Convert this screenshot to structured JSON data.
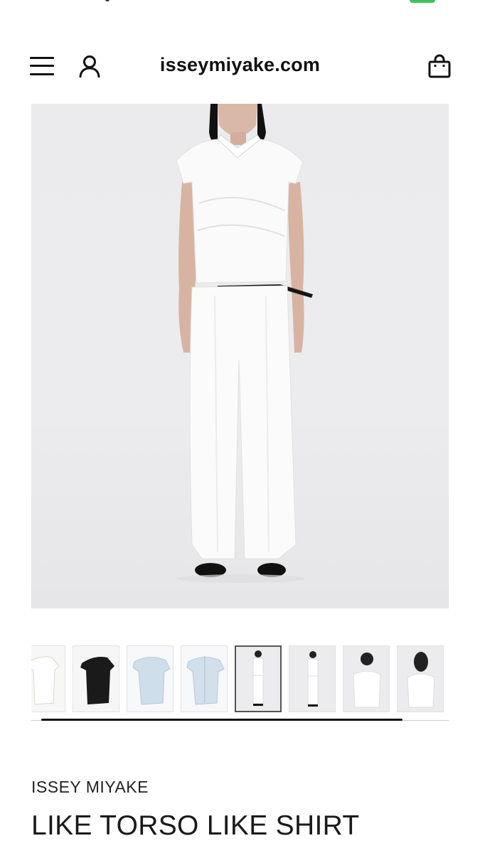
{
  "header": {
    "site_title": "isseymiyake.com",
    "icons": {
      "menu": "hamburger-menu-icon",
      "account": "user-icon",
      "cart": "shopping-bag-icon"
    }
  },
  "product": {
    "brand": "ISSEY MIYAKE",
    "title": "LIKE TORSO LIKE SHIRT"
  },
  "gallery": {
    "thumbnail_count": 8,
    "selected_index": 4,
    "thumbnails": [
      {
        "color": "white",
        "view": "shirt-front"
      },
      {
        "color": "black",
        "view": "shirt-front"
      },
      {
        "color": "light-blue",
        "view": "shirt-front"
      },
      {
        "color": "light-blue",
        "view": "shirt-back"
      },
      {
        "color": "white",
        "view": "model-full-front"
      },
      {
        "color": "white",
        "view": "model-full-angle"
      },
      {
        "color": "white",
        "view": "model-half"
      },
      {
        "color": "white",
        "view": "model-back"
      }
    ]
  },
  "colors": {
    "text": "#111111",
    "hero_bg": "#ebebed",
    "battery": "#3cc35b"
  }
}
